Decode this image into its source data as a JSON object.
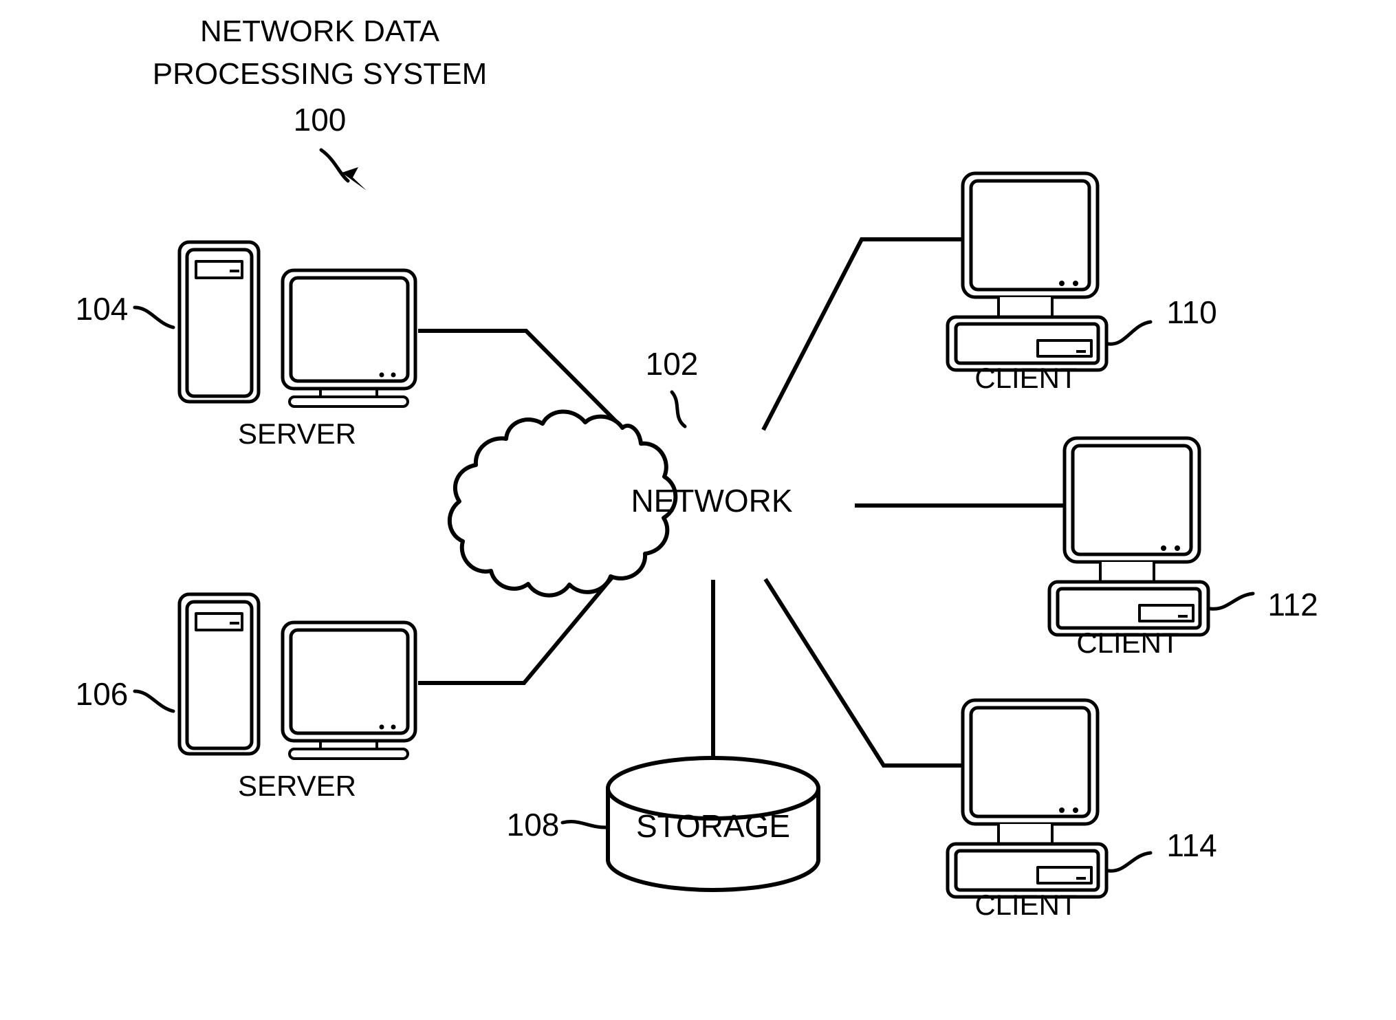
{
  "figure": {
    "title_lines": [
      "NETWORK DATA",
      "PROCESSING SYSTEM"
    ],
    "title_ref": "100",
    "background_color": "#ffffff",
    "line_color": "#000000"
  },
  "nodes": {
    "network": {
      "label": "NETWORK",
      "ref": "102",
      "shape": "cloud"
    },
    "storage": {
      "label": "STORAGE",
      "ref": "108",
      "shape": "cylinder"
    },
    "server_top": {
      "label": "SERVER",
      "ref": "104",
      "shape": "tower-and-monitor"
    },
    "server_bottom": {
      "label": "SERVER",
      "ref": "106",
      "shape": "tower-and-monitor"
    },
    "client_top": {
      "label": "CLIENT",
      "ref": "110",
      "shape": "desktop-computer"
    },
    "client_middle": {
      "label": "CLIENT",
      "ref": "112",
      "shape": "desktop-computer"
    },
    "client_bottom": {
      "label": "CLIENT",
      "ref": "114",
      "shape": "desktop-computer"
    }
  },
  "connections": [
    {
      "from": "server_top",
      "to": "network"
    },
    {
      "from": "server_bottom",
      "to": "network"
    },
    {
      "from": "network",
      "to": "client_top"
    },
    {
      "from": "network",
      "to": "client_middle"
    },
    {
      "from": "network",
      "to": "client_bottom"
    },
    {
      "from": "network",
      "to": "storage"
    }
  ]
}
